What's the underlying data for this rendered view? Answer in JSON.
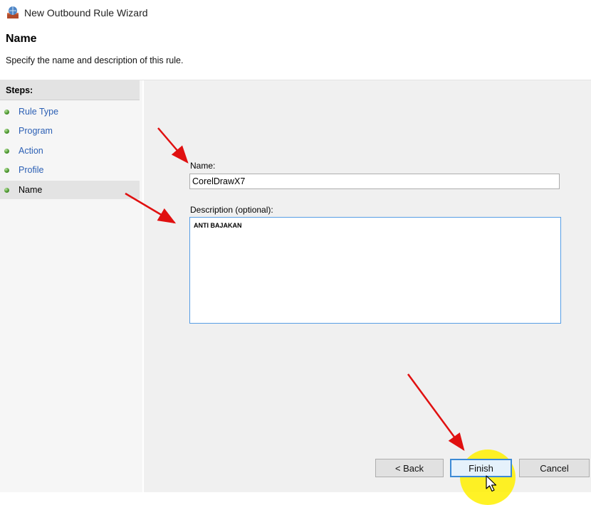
{
  "window": {
    "title": "New Outbound Rule Wizard",
    "icon": "firewall-wizard-icon"
  },
  "header": {
    "title": "Name",
    "subtitle": "Specify the name and description of this rule."
  },
  "sidebar": {
    "heading": "Steps:",
    "items": [
      {
        "label": "Rule Type",
        "active": false
      },
      {
        "label": "Program",
        "active": false
      },
      {
        "label": "Action",
        "active": false
      },
      {
        "label": "Profile",
        "active": false
      },
      {
        "label": "Name",
        "active": true
      }
    ]
  },
  "form": {
    "name_label": "Name:",
    "name_value": "CorelDrawX7",
    "description_label": "Description (optional):",
    "description_value": "ANTI BAJAKAN"
  },
  "buttons": {
    "back": "< Back",
    "finish": "Finish",
    "cancel": "Cancel"
  },
  "colors": {
    "annotation_arrow": "#e01010",
    "click_highlight": "#fff000",
    "focus_border": "#3c8ad6",
    "step_link": "#2b5fb4"
  }
}
